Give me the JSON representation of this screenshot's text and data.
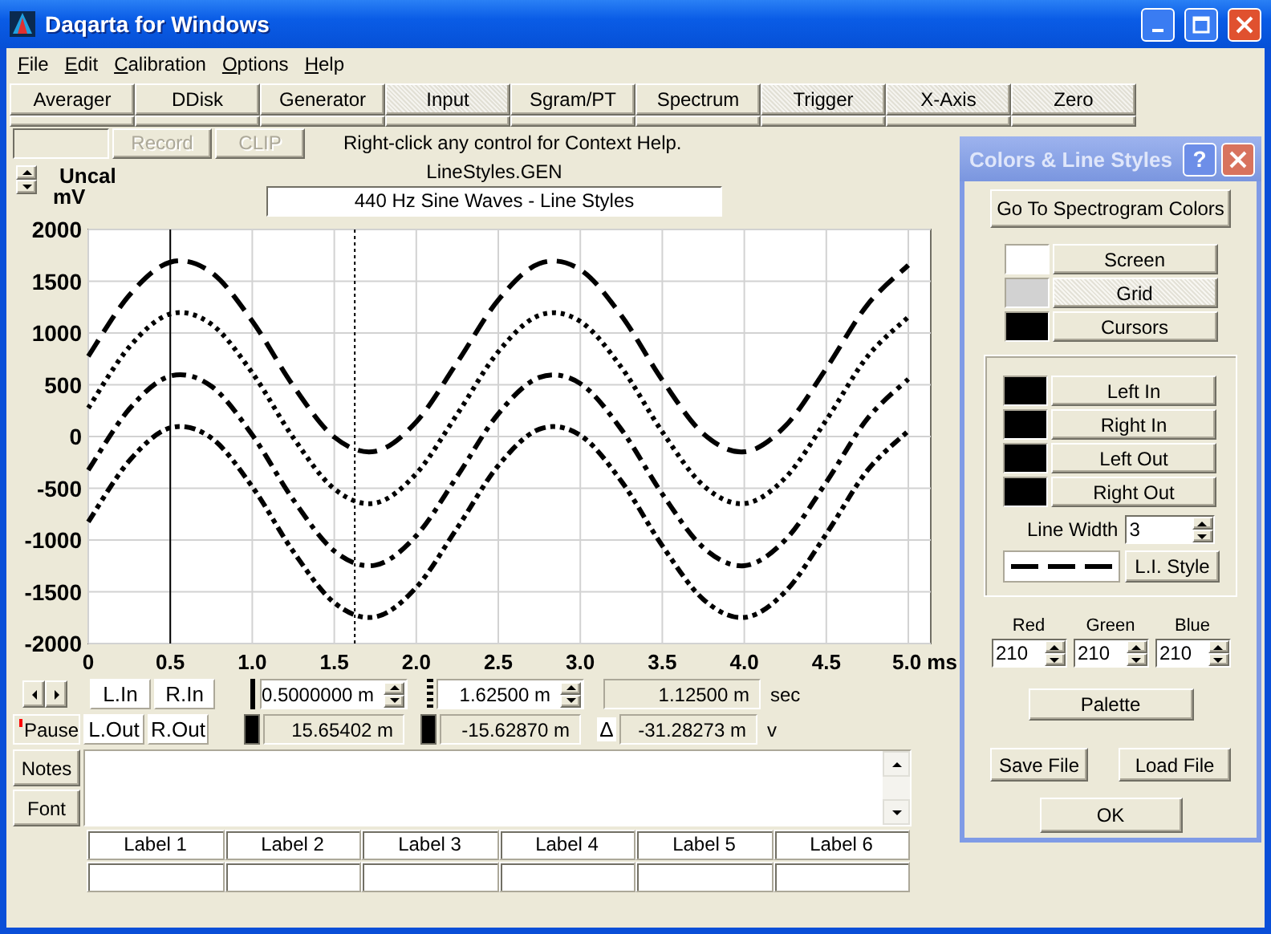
{
  "window": {
    "title": "Daqarta for Windows"
  },
  "menu": [
    "File",
    "Edit",
    "Calibration",
    "Options",
    "Help"
  ],
  "tabs": [
    {
      "label": "Averager",
      "pressed": false
    },
    {
      "label": "DDisk",
      "pressed": false
    },
    {
      "label": "Generator",
      "pressed": false
    },
    {
      "label": "Input",
      "pressed": true
    },
    {
      "label": "Sgram/PT",
      "pressed": false
    },
    {
      "label": "Spectrum",
      "pressed": false
    },
    {
      "label": "Trigger",
      "pressed": true
    },
    {
      "label": "X-Axis",
      "pressed": true
    },
    {
      "label": "Zero",
      "pressed": true
    }
  ],
  "toolbar": {
    "buttons": [
      {
        "label": "Record",
        "disabled": true
      },
      {
        "label": "CLIP",
        "disabled": true
      }
    ],
    "hint": "Right-click any control for Context Help."
  },
  "y_units": [
    "Uncal",
    "mV"
  ],
  "file_name": "LineStyles.GEN",
  "trace_title": "440 Hz Sine Waves - Line Styles",
  "chart_data": {
    "type": "line",
    "x": [
      0,
      0.25,
      0.5,
      0.75,
      1,
      1.25,
      1.5,
      1.75,
      2,
      2.25,
      2.5,
      2.75,
      3,
      3.25,
      3.5,
      3.75,
      4,
      4.25,
      4.5,
      4.75,
      5
    ],
    "series": [
      {
        "line_style": "dashed",
        "color": "#000000",
        "values": [
          775,
          1365,
          1684,
          1586,
          1115,
          489,
          -6,
          -143,
          142,
          717,
          1319,
          1671,
          1612,
          1169,
          545,
          27,
          -148,
          101,
          659,
          1271,
          1655
        ]
      },
      {
        "line_style": "dotted",
        "color": "#000000",
        "values": [
          275,
          865,
          1184,
          1086,
          615,
          -11,
          -506,
          -643,
          -358,
          217,
          819,
          1171,
          1112,
          669,
          45,
          -473,
          -648,
          -399,
          159,
          771,
          1155
        ]
      },
      {
        "line_style": "dashdot",
        "color": "#000000",
        "values": [
          -325,
          265,
          584,
          486,
          15,
          -611,
          -1106,
          -1243,
          -958,
          -383,
          219,
          571,
          512,
          69,
          -555,
          -1073,
          -1248,
          -999,
          -441,
          171,
          555
        ]
      },
      {
        "line_style": "dashdotdot",
        "color": "#000000",
        "values": [
          -825,
          -235,
          84,
          -14,
          -485,
          -1111,
          -1606,
          -1743,
          -1458,
          -883,
          -281,
          71,
          12,
          -431,
          -1055,
          -1573,
          -1748,
          -1499,
          -941,
          -329,
          55
        ]
      }
    ],
    "xlim": [
      0,
      5
    ],
    "ylim": [
      -2000,
      2000
    ],
    "xticks": [
      {
        "value": 0,
        "label": "0"
      },
      {
        "value": 0.5,
        "label": "0.5"
      },
      {
        "value": 1,
        "label": "1.0"
      },
      {
        "value": 1.5,
        "label": "1.5"
      },
      {
        "value": 2,
        "label": "2.0"
      },
      {
        "value": 2.5,
        "label": "2.5"
      },
      {
        "value": 3,
        "label": "3.0"
      },
      {
        "value": 3.5,
        "label": "3.5"
      },
      {
        "value": 4,
        "label": "4.0"
      },
      {
        "value": 4.5,
        "label": "4.5"
      },
      {
        "value": 5,
        "label": "5.0 ms"
      }
    ],
    "yticks": [
      2000,
      1500,
      1000,
      500,
      0,
      -500,
      -1000,
      -1500,
      -2000
    ],
    "grid": true,
    "ref_lines": [
      {
        "axis": "x",
        "value": 0.5,
        "line_style": "solid",
        "color": "#000000"
      },
      {
        "axis": "x",
        "value": 1.625,
        "line_style": "dotted",
        "color": "#000000"
      }
    ]
  },
  "channels": [
    {
      "label": "L.In"
    },
    {
      "label": "R.In"
    },
    {
      "label": "L.Out"
    },
    {
      "label": "R.Out"
    }
  ],
  "pause": {
    "label": "Pause",
    "on": true
  },
  "cursors": [
    {
      "kind": "solid",
      "time": "0.5000000 m",
      "level": "15.65402 m"
    },
    {
      "kind": "dotted",
      "time": "1.62500 m",
      "level": "-15.62870 m"
    }
  ],
  "delta": {
    "symbol": "Δ",
    "time": "1.12500 m",
    "level": "-31.28273 m"
  },
  "units": {
    "time": "sec",
    "level": "v"
  },
  "notes_buttons": [
    "Notes",
    "Font"
  ],
  "labels": [
    "Label 1",
    "Label 2",
    "Label 3",
    "Label 4",
    "Label 5",
    "Label 6"
  ],
  "dialog": {
    "title": "Colors & Line Styles",
    "help": "?",
    "spectrogram_button": "Go To Spectrogram Colors",
    "color_items": [
      {
        "label": "Screen",
        "color": "#ffffff",
        "selected": false
      },
      {
        "label": "Grid",
        "color": "#d2d2d2",
        "selected": true
      },
      {
        "label": "Cursors",
        "color": "#000000",
        "selected": false
      }
    ],
    "trace_items": [
      {
        "label": "Left In",
        "color": "#000000"
      },
      {
        "label": "Right In",
        "color": "#000000"
      },
      {
        "label": "Left Out",
        "color": "#000000"
      },
      {
        "label": "Right Out",
        "color": "#000000"
      }
    ],
    "line_width": {
      "label": "Line Width",
      "value": "3"
    },
    "style_button": "L.I. Style",
    "rgb": [
      {
        "label": "Red",
        "value": "210"
      },
      {
        "label": "Green",
        "value": "210"
      },
      {
        "label": "Blue",
        "value": "210"
      }
    ],
    "palette_button": "Palette",
    "file_buttons": [
      "Save File",
      "Load File"
    ],
    "ok_button": "OK"
  }
}
